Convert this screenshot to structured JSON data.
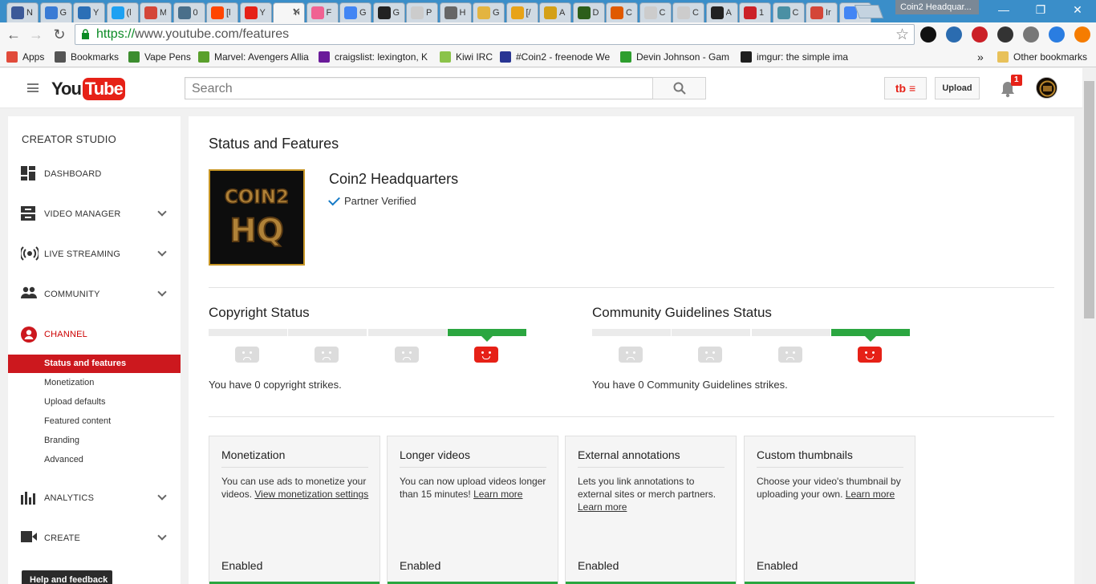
{
  "window": {
    "title": "Coin2 Headquar...",
    "min": "—",
    "max": "❐",
    "close": "✕"
  },
  "tabs": [
    {
      "label": "N",
      "color": "#3b5998"
    },
    {
      "label": "G",
      "color": "#3a7bd5"
    },
    {
      "label": "Y",
      "color": "#2c6fb6"
    },
    {
      "label": "(l",
      "color": "#1da1f2"
    },
    {
      "label": "M",
      "color": "#d44638"
    },
    {
      "label": "0",
      "color": "#4a6f8a"
    },
    {
      "label": "[l",
      "color": "#ff4500"
    },
    {
      "label": "Y",
      "color": "#e62117"
    },
    {
      "label": "Yo",
      "color": "#f6f6f6",
      "active": true
    },
    {
      "label": "F",
      "color": "#f06292"
    },
    {
      "label": "G",
      "color": "#4285f4"
    },
    {
      "label": "G",
      "color": "#222222"
    },
    {
      "label": "P",
      "color": "#cccccc"
    },
    {
      "label": "H",
      "color": "#666666"
    },
    {
      "label": "G",
      "color": "#e3b440"
    },
    {
      "label": "[/",
      "color": "#e8a317"
    },
    {
      "label": "A",
      "color": "#d4a017"
    },
    {
      "label": "D",
      "color": "#2c5e1a"
    },
    {
      "label": "C",
      "color": "#e05a00"
    },
    {
      "label": "C",
      "color": "#cccccc"
    },
    {
      "label": "C",
      "color": "#cccccc"
    },
    {
      "label": "A",
      "color": "#222222"
    },
    {
      "label": "1",
      "color": "#cb2027"
    },
    {
      "label": "C",
      "color": "#4a90a4"
    },
    {
      "label": "Ir",
      "color": "#d44638"
    },
    {
      "label": "is",
      "color": "#4285f4"
    }
  ],
  "tab_close": "✕",
  "toolbar": {
    "back": "←",
    "forward": "→",
    "reload": "↻",
    "scheme": "https://",
    "url_rest": "www.youtube.com/features",
    "star": "☆"
  },
  "extensions": [
    {
      "name": "ext-1",
      "color": "#111111"
    },
    {
      "name": "ext-2",
      "color": "#2b6cb0"
    },
    {
      "name": "pinterest",
      "color": "#cb2027"
    },
    {
      "name": "ext-4",
      "color": "#333333"
    },
    {
      "name": "tubebuddy",
      "color": "#777777"
    },
    {
      "name": "ext-6",
      "color": "#2a7de1"
    },
    {
      "name": "menu",
      "color": "#f57c00"
    }
  ],
  "bookmarks": [
    {
      "label": "Apps",
      "color": "#e14b3b"
    },
    {
      "label": "Bookmarks",
      "color": "#555555"
    },
    {
      "label": "Vape Pens",
      "color": "#3c8d2f"
    },
    {
      "label": "Marvel: Avengers Allia",
      "color": "#5aa02c"
    },
    {
      "label": "craigslist: lexington, K",
      "color": "#6a1b9a"
    },
    {
      "label": "Kiwi IRC",
      "color": "#8bc34a"
    },
    {
      "label": "#Coin2 - freenode We",
      "color": "#283593"
    },
    {
      "label": "Devin Johnson - Gam",
      "color": "#2e9e2e"
    },
    {
      "label": "imgur: the simple ima",
      "color": "#1e1e1e"
    }
  ],
  "bookmarks_overflow": "»",
  "other_bookmarks": "Other bookmarks",
  "youtube": {
    "logo_you": "You",
    "logo_tube": "Tube",
    "search_placeholder": "Search",
    "tb_label": "tb ≡",
    "upload": "Upload",
    "notifications": "1"
  },
  "sidebar": {
    "heading": "CREATOR STUDIO",
    "items": [
      {
        "label": "DASHBOARD",
        "icon": "dashboard-icon"
      },
      {
        "label": "VIDEO MANAGER",
        "icon": "video-manager-icon"
      },
      {
        "label": "LIVE STREAMING",
        "icon": "live-streaming-icon"
      },
      {
        "label": "COMMUNITY",
        "icon": "community-icon"
      },
      {
        "label": "CHANNEL",
        "icon": "channel-icon",
        "active": true
      },
      {
        "label": "ANALYTICS",
        "icon": "analytics-icon"
      },
      {
        "label": "CREATE",
        "icon": "create-icon"
      }
    ],
    "channel_sub": [
      "Status and features",
      "Monetization",
      "Upload defaults",
      "Featured content",
      "Branding",
      "Advanced"
    ],
    "help": "Help and feedback"
  },
  "main": {
    "title": "Status and Features",
    "channel_name": "Coin2 Headquarters",
    "channel_logo_line1": "COIN2",
    "channel_logo_line2": "HQ",
    "verified": "Partner Verified",
    "copyright": {
      "title": "Copyright Status",
      "desc": "You have 0 copyright strikes."
    },
    "community": {
      "title": "Community Guidelines Status",
      "desc": "You have 0 Community Guidelines strikes."
    },
    "features": [
      {
        "title": "Monetization",
        "desc": "You can use ads to monetize your videos.",
        "link": "View monetization settings",
        "status": "Enabled"
      },
      {
        "title": "Longer videos",
        "desc": "You can now upload videos longer than 15 minutes!",
        "link": "Learn more",
        "status": "Enabled"
      },
      {
        "title": "External annotations",
        "desc": "Lets you link annotations to external sites or merch partners.",
        "link": "Learn more",
        "status": "Enabled"
      },
      {
        "title": "Custom thumbnails",
        "desc": "Choose your video's thumbnail by uploading your own.",
        "link": "Learn more",
        "status": "Enabled"
      }
    ]
  },
  "colors": {
    "youtube_red": "#e62117",
    "sidebar_selected": "#cc181e",
    "good_status": "#2ba640",
    "link_blue": "#167ac6"
  }
}
